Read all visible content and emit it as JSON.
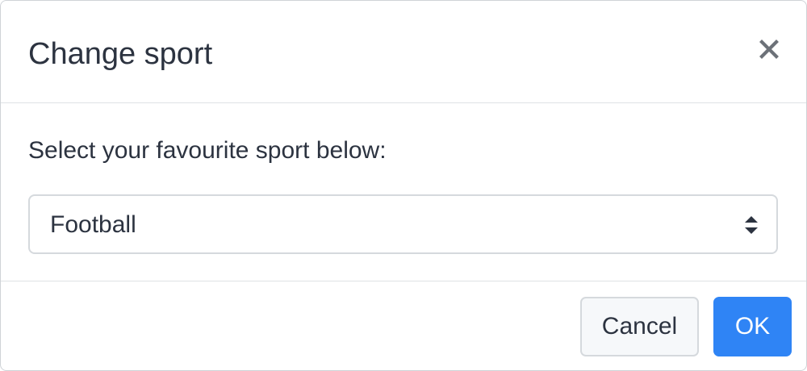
{
  "dialog": {
    "title": "Change sport",
    "close_icon": "close-icon"
  },
  "body": {
    "prompt": "Select your favourite sport below:",
    "sport_select": {
      "selected": "Football",
      "icon": "select-updown-arrows-icon"
    }
  },
  "footer": {
    "cancel_label": "Cancel",
    "ok_label": "OK"
  },
  "colors": {
    "primary": "#2f84f5",
    "text": "#2c3340",
    "border": "#d5d9dd",
    "cancel_bg": "#f6f8fa"
  }
}
